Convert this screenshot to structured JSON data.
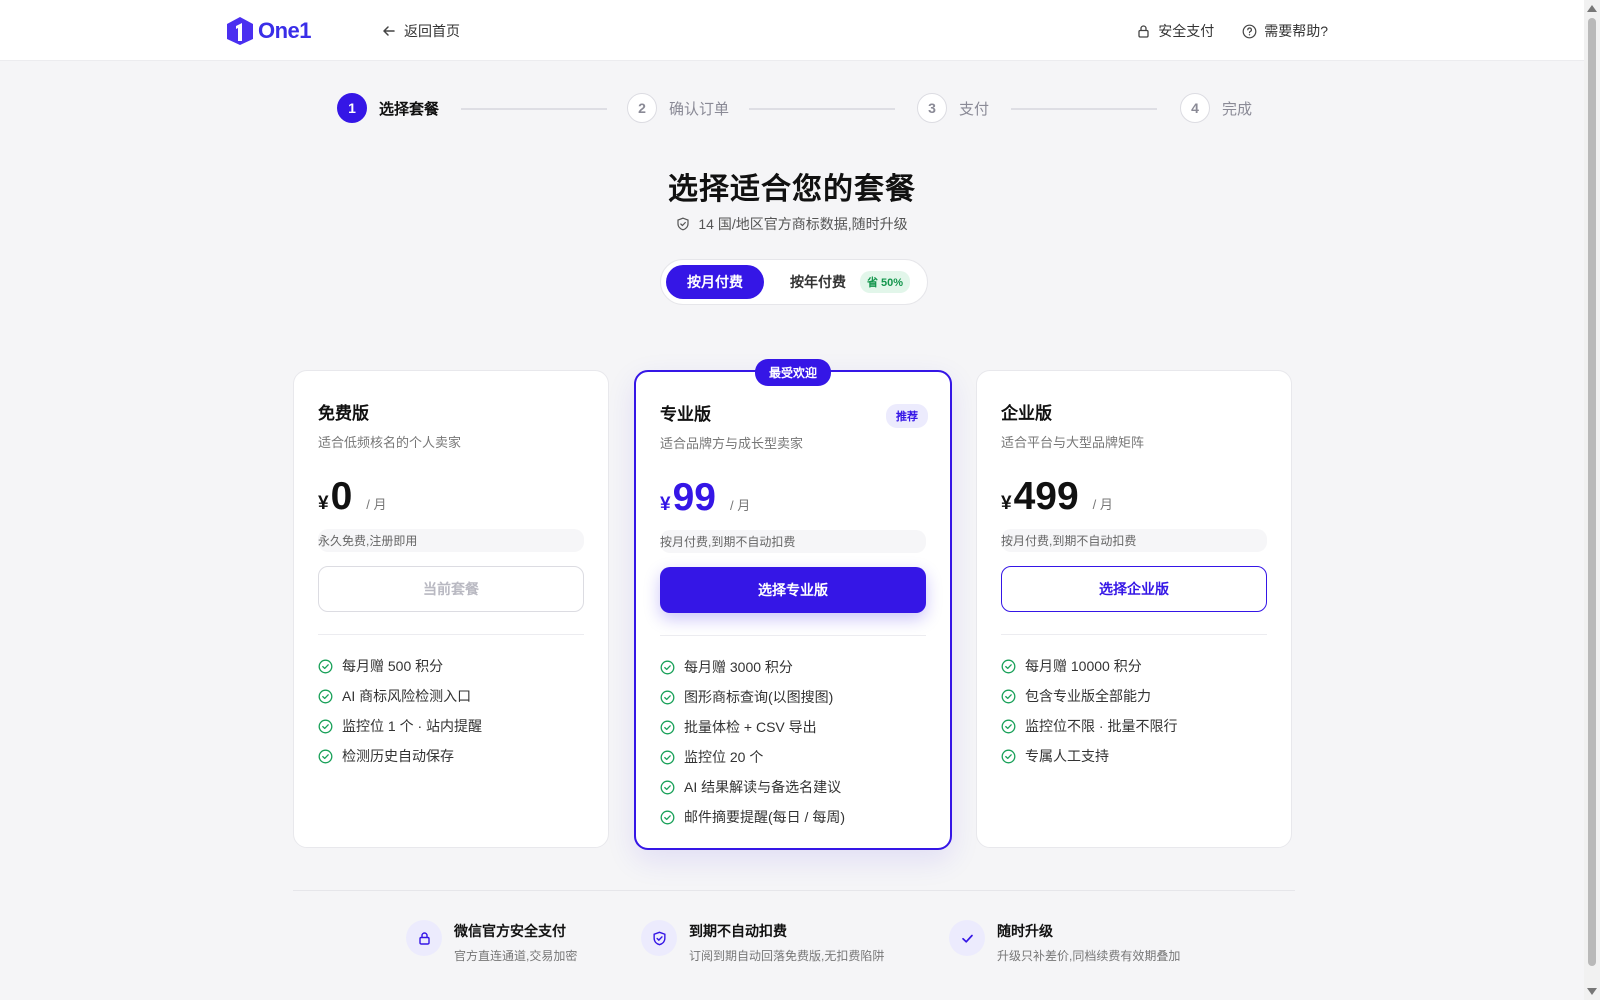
{
  "header": {
    "brand": "One1",
    "back_label": "返回首页",
    "secure_pay_label": "安全支付",
    "help_label": "需要帮助?"
  },
  "steps": [
    {
      "num": "1",
      "label": "选择套餐"
    },
    {
      "num": "2",
      "label": "确认订单"
    },
    {
      "num": "3",
      "label": "支付"
    },
    {
      "num": "4",
      "label": "完成"
    }
  ],
  "heading": {
    "title": "选择适合您的套餐",
    "subtitle": "14 国/地区官方商标数据,随时升级"
  },
  "billing": {
    "monthly": "按月付费",
    "yearly": "按年付费",
    "save_badge": "省 50%"
  },
  "plans": [
    {
      "name": "免费版",
      "desc": "适合低频核名的个人卖家",
      "currency": "¥",
      "price": "0",
      "period": "/ 月",
      "note": "永久免费,注册即用",
      "cta": "当前套餐",
      "features": [
        "每月赠 500 积分",
        "AI 商标风险检测入口",
        "监控位 1 个 · 站内提醒",
        "检测历史自动保存"
      ]
    },
    {
      "name": "专业版",
      "badge_popular": "最受欢迎",
      "badge_recommend": "推荐",
      "desc": "适合品牌方与成长型卖家",
      "currency": "¥",
      "price": "99",
      "period": "/ 月",
      "note": "按月付费,到期不自动扣费",
      "cta": "选择专业版",
      "features": [
        "每月赠 3000 积分",
        "图形商标查询(以图搜图)",
        "批量体检 + CSV 导出",
        "监控位 20 个",
        "AI 结果解读与备选名建议",
        "邮件摘要提醒(每日 / 每周)"
      ]
    },
    {
      "name": "企业版",
      "desc": "适合平台与大型品牌矩阵",
      "currency": "¥",
      "price": "499",
      "period": "/ 月",
      "note": "按月付费,到期不自动扣费",
      "cta": "选择企业版",
      "features": [
        "每月赠 10000 积分",
        "包含专业版全部能力",
        "监控位不限 · 批量不限行",
        "专属人工支持"
      ]
    }
  ],
  "trust": [
    {
      "title": "微信官方安全支付",
      "desc": "官方直连通道,交易加密"
    },
    {
      "title": "到期不自动扣费",
      "desc": "订阅到期自动回落免费版,无扣费陷阱"
    },
    {
      "title": "随时升级",
      "desc": "升级只补差价,同档续费有效期叠加"
    }
  ],
  "colors": {
    "accent": "#3516e6",
    "success": "#14964d"
  }
}
